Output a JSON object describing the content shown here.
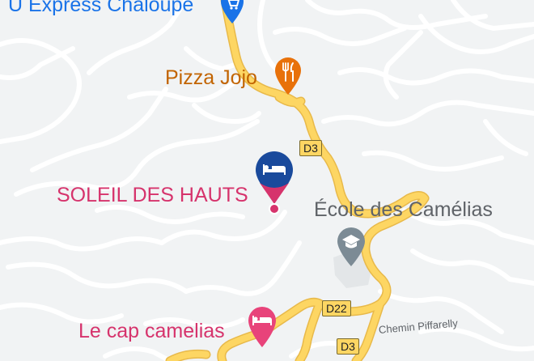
{
  "map": {
    "colors": {
      "land": "#f1f3f4",
      "minor_road": "#ffffff",
      "major_road": "#fdd663",
      "major_road_casing": "#e8b94a",
      "hotel": "#d6336c",
      "hotel_selected_pin": "#1a4a9c",
      "restaurant": "#e8710a",
      "shop": "#1a73e8",
      "school_pin": "#7c8b95",
      "school_area": "#e3e6e8"
    },
    "pois": [
      {
        "id": "u-express",
        "label": "U Express Chaloupe",
        "category": "shop",
        "icon": "shopping-cart-icon"
      },
      {
        "id": "pizza-jojo",
        "label": "Pizza Jojo",
        "category": "restaurant",
        "icon": "fork-knife-icon"
      },
      {
        "id": "soleil-des-hauts",
        "label": "SOLEIL DES HAUTS",
        "category": "hotel-selected",
        "icon": "bed-icon"
      },
      {
        "id": "ecole-camelias",
        "label": "École des Camélias",
        "category": "school",
        "icon": "graduation-cap-icon"
      },
      {
        "id": "cap-camelias",
        "label": "Le cap camelias",
        "category": "hotel",
        "icon": "bed-icon"
      }
    ],
    "route_shields": [
      "D3",
      "D22",
      "D3"
    ],
    "street_labels": [
      "Chemin Piffarelly"
    ]
  }
}
